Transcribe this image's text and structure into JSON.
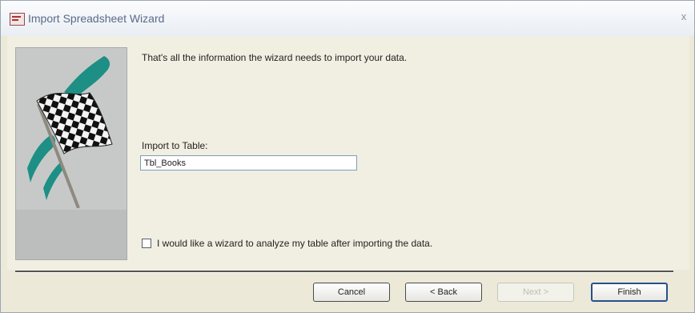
{
  "window": {
    "title": "Import Spreadsheet Wizard",
    "close_glyph": "x"
  },
  "icons": {
    "app": "access-table-icon",
    "wizard_image": "checkered-flag-icon",
    "close": "close-icon"
  },
  "main": {
    "message": "That's all the information the wizard needs to import your data.",
    "import_table_label": "Import to Table:",
    "import_table_value": "Tbl_Books",
    "analyze_checkbox_label": "I would like a wizard to analyze my table after importing the data.",
    "analyze_checked": false
  },
  "buttons": {
    "cancel": "Cancel",
    "back": "< Back",
    "next": "Next >",
    "finish": "Finish"
  },
  "colors": {
    "dialog_background": "#ece9d8",
    "flag_teal": "#1e8f84",
    "title_text": "#5a6a88",
    "default_button_border": "#2a4f8c"
  }
}
